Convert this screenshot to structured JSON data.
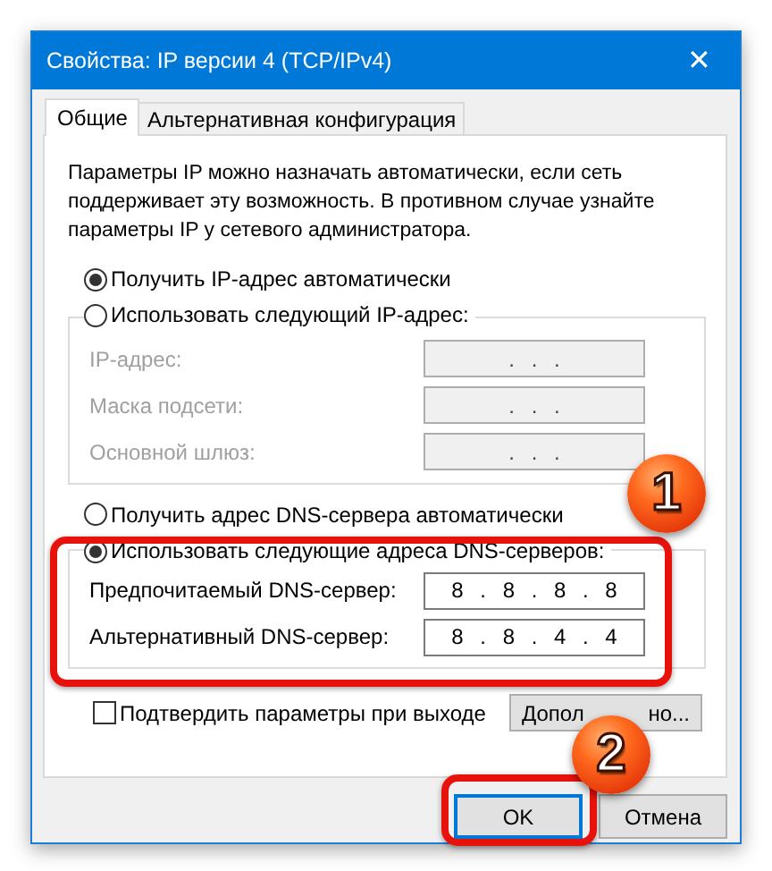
{
  "window": {
    "title": "Свойства: IP версии 4 (TCP/IPv4)",
    "close": "✕"
  },
  "tabs": [
    {
      "label": "Общие",
      "selected": true
    },
    {
      "label": "Альтернативная конфигурация",
      "selected": false
    }
  ],
  "description": "Параметры IP можно назначать автоматически, если сеть поддерживает эту возможность. В противном случае узнайте параметры IP у сетевого администратора.",
  "ip": {
    "auto": {
      "label": "Получить IP-адрес автоматически",
      "selected": true
    },
    "manual": {
      "label": "Использовать следующий IP-адрес:",
      "selected": false
    },
    "fields": [
      {
        "label": "IP-адрес:",
        "value": ". . .",
        "disabled": true
      },
      {
        "label": "Маска подсети:",
        "value": ". . .",
        "disabled": true
      },
      {
        "label": "Основной шлюз:",
        "value": ". . .",
        "disabled": true
      }
    ]
  },
  "dns": {
    "auto": {
      "label": "Получить адрес DNS-сервера автоматически",
      "selected": false
    },
    "manual": {
      "label": "Использовать следующие адреса DNS-серверов:",
      "selected": true
    },
    "fields": [
      {
        "label": "Предпочитаемый DNS-сервер:",
        "value": "8 . 8 . 8 . 8",
        "disabled": false
      },
      {
        "label": "Альтернативный DNS-сервер:",
        "value": "8 . 8 . 4 . 4",
        "disabled": false
      }
    ]
  },
  "validate": {
    "label": "Подтвердить параметры при выходе",
    "checked": false
  },
  "advanced_button": {
    "label_parts": [
      "Допол",
      "но..."
    ]
  },
  "buttons": [
    {
      "label": "OK",
      "focused": true
    },
    {
      "label": "Отмена",
      "focused": false
    }
  ],
  "annotations": [
    {
      "number": "1"
    },
    {
      "number": "2"
    }
  ]
}
